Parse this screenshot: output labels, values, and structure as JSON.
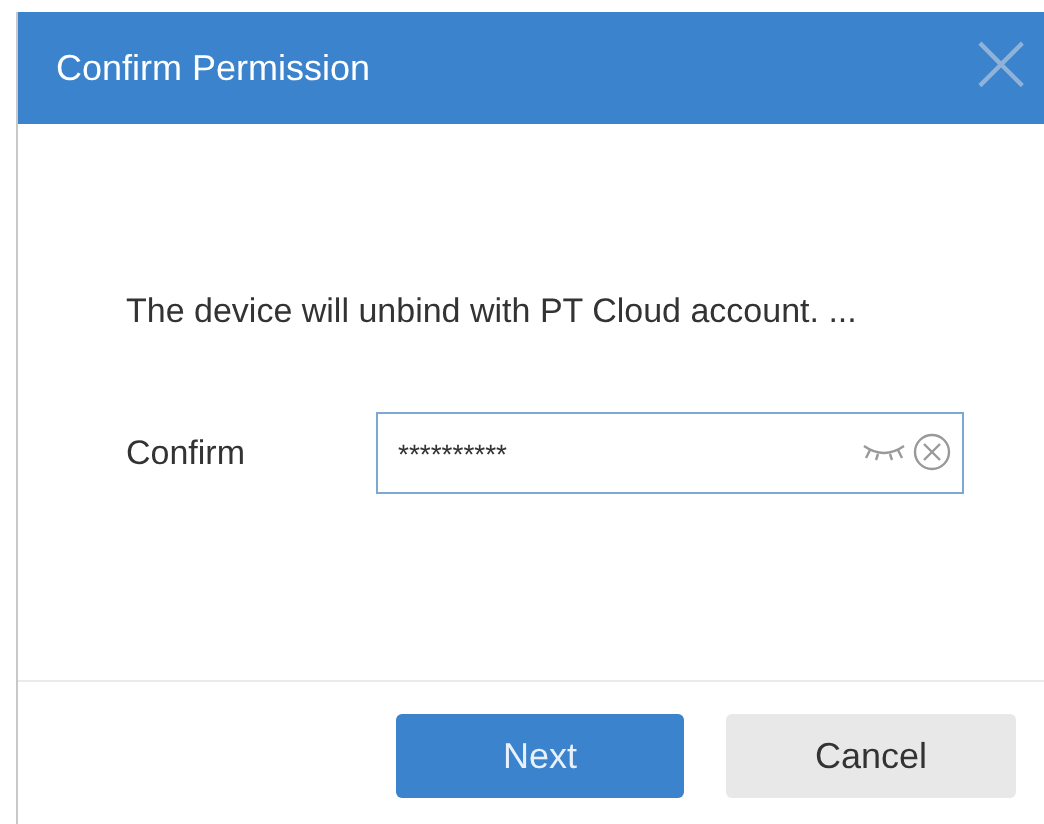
{
  "dialog": {
    "title": "Confirm Permission",
    "close": "×"
  },
  "message": "The device will unbind with PT Cloud account. ...",
  "field": {
    "label": "Confirm",
    "value": "**********"
  },
  "buttons": [
    {
      "label": "Next",
      "kind": "primary"
    },
    {
      "label": "Cancel",
      "kind": "secondary"
    }
  ]
}
